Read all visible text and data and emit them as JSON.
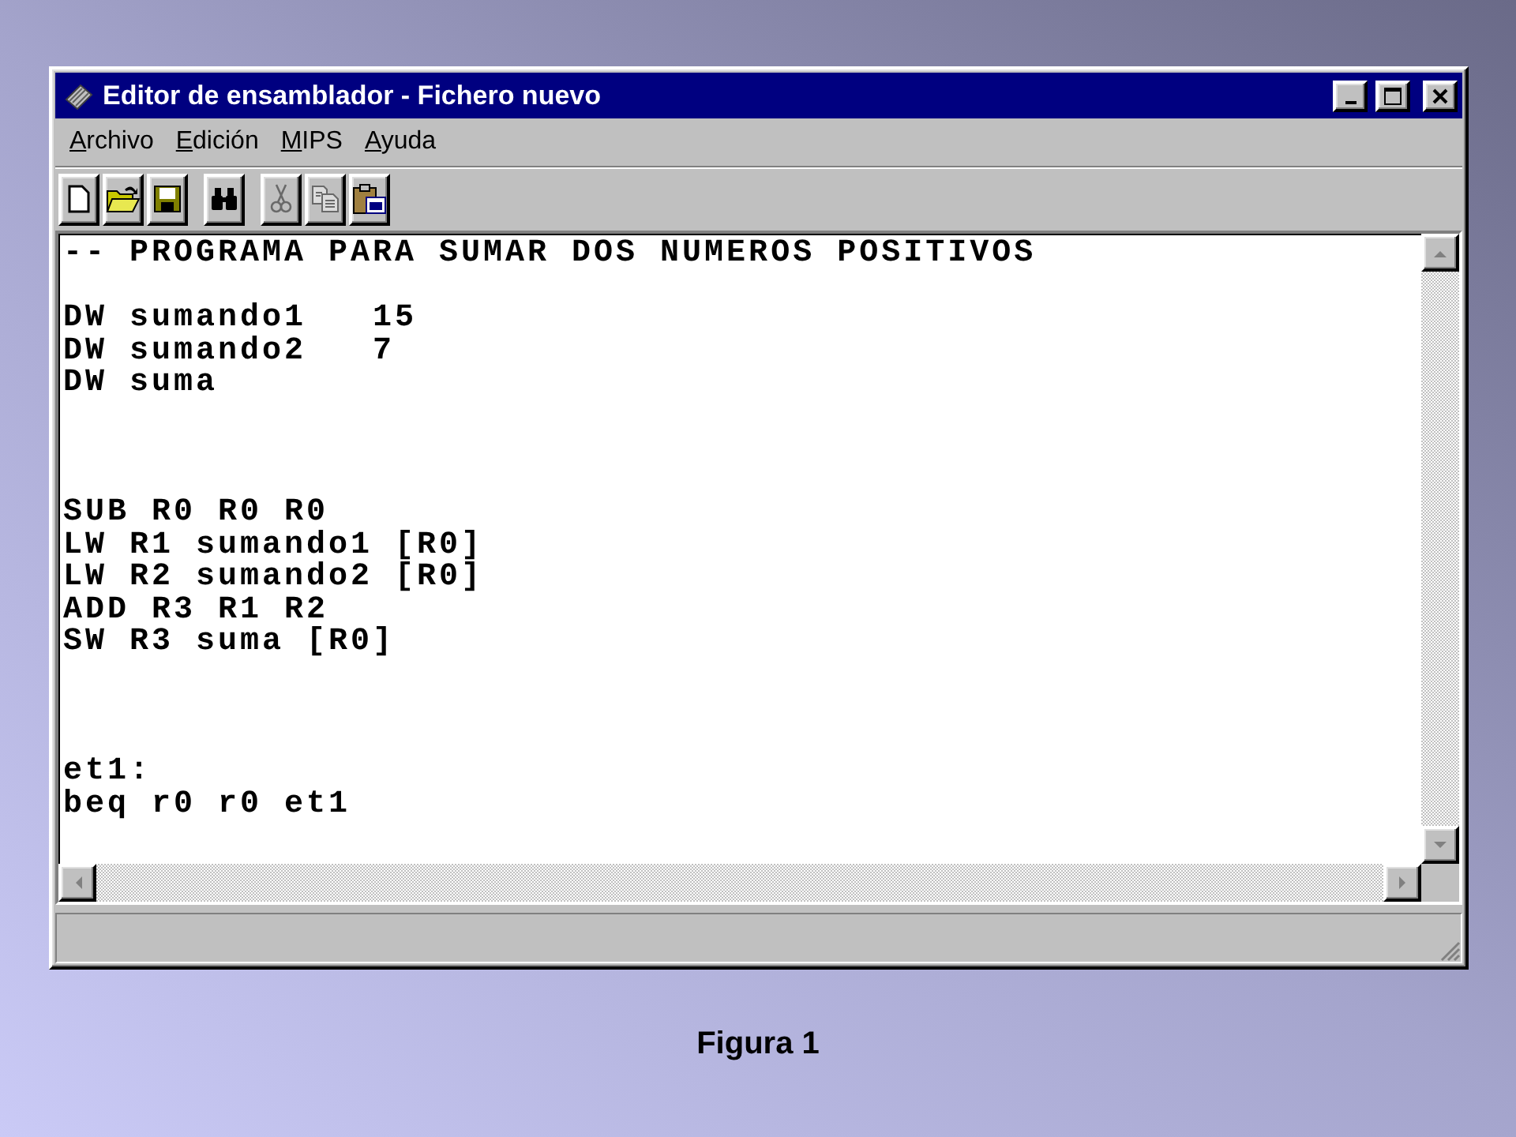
{
  "window": {
    "title": "Editor de ensamblador - Fichero nuevo"
  },
  "menu": [
    "Archivo",
    "Edición",
    "MIPS",
    "Ayuda"
  ],
  "toolbar": [
    {
      "buttons": [
        {
          "kind": "new",
          "disabled": false
        },
        {
          "kind": "open",
          "disabled": false
        },
        {
          "kind": "save",
          "disabled": false
        }
      ]
    },
    {
      "buttons": [
        {
          "kind": "find",
          "disabled": false
        }
      ]
    },
    {
      "buttons": [
        {
          "kind": "cut",
          "disabled": true
        },
        {
          "kind": "copy",
          "disabled": true
        },
        {
          "kind": "paste",
          "disabled": false
        }
      ]
    }
  ],
  "editor": {
    "code": "-- PROGRAMA PARA SUMAR DOS NUMEROS POSITIVOS\n\nDW sumando1   15\nDW sumando2   7\nDW suma\n\n\n\nSUB R0 R0 R0\nLW R1 sumando1 [R0]\nLW R2 sumando2 [R0]\nADD R3 R1 R2\nSW R3 suma [R0]\n\n\n\net1:\nbeq r0 r0 et1"
  },
  "caption": "Figura 1"
}
